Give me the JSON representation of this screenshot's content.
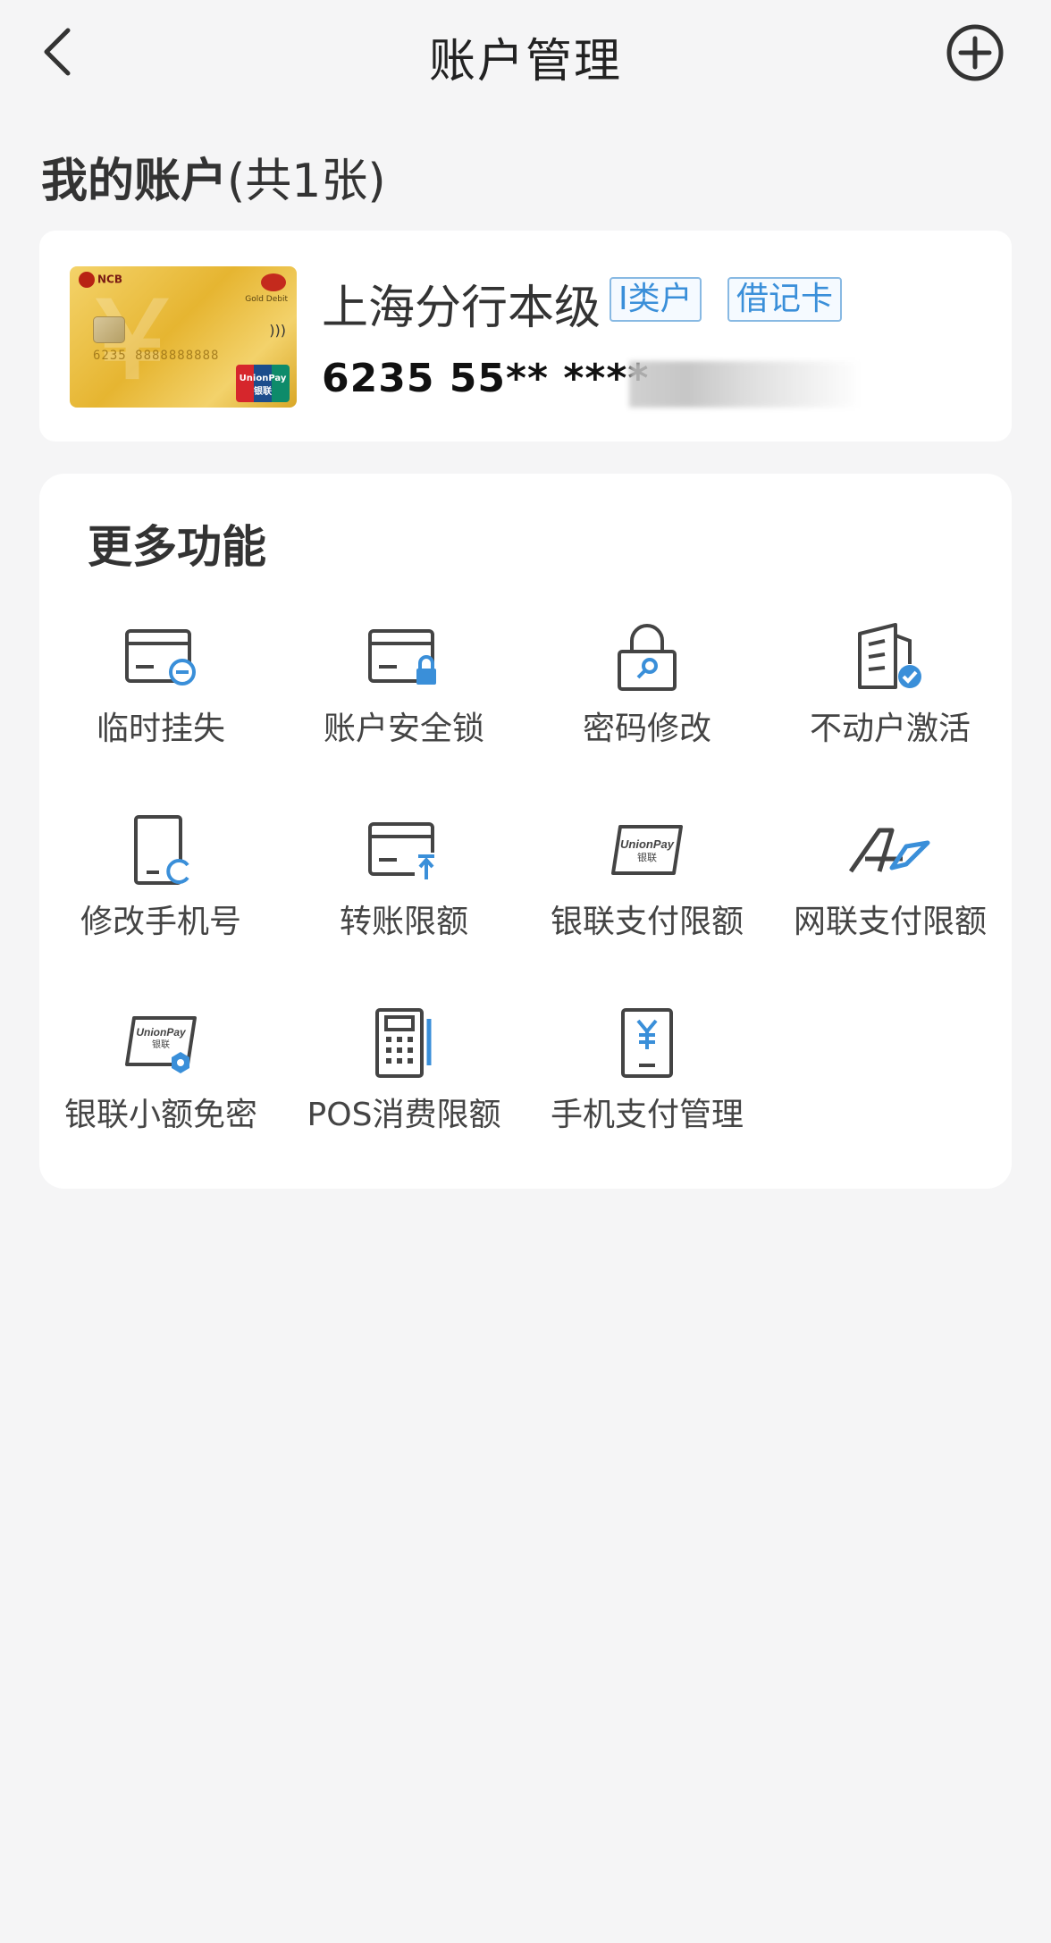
{
  "header": {
    "title": "账户管理",
    "back_icon": "chevron-left-icon",
    "add_icon": "plus-circle-icon"
  },
  "accounts": {
    "title": "我的账户",
    "count_text": "(共1张)"
  },
  "account_card": {
    "branch": "上海分行本级",
    "tag_class": "I类户",
    "tag_type": "借记卡",
    "card_number": "6235 55** ****",
    "card_brand_text": "NCB",
    "card_type_text": "Gold Debit",
    "unionpay_text": "UnionPay 银联"
  },
  "functions": {
    "title": "更多功能",
    "items": [
      {
        "label": "临时挂失",
        "icon": "card-minus-icon"
      },
      {
        "label": "账户安全锁",
        "icon": "card-lock-icon"
      },
      {
        "label": "密码修改",
        "icon": "padlock-key-icon"
      },
      {
        "label": "不动户激活",
        "icon": "building-check-icon"
      },
      {
        "label": "修改手机号",
        "icon": "phone-refresh-icon"
      },
      {
        "label": "转账限额",
        "icon": "card-upload-icon"
      },
      {
        "label": "银联支付限额",
        "icon": "unionpay-card-icon"
      },
      {
        "label": "网联支付限额",
        "icon": "netunion-logo-icon"
      },
      {
        "label": "银联小额免密",
        "icon": "unionpay-badge-icon"
      },
      {
        "label": "POS消费限额",
        "icon": "pos-terminal-icon"
      },
      {
        "label": "手机支付管理",
        "icon": "phone-yuan-icon"
      }
    ]
  },
  "colors": {
    "accent": "#3a8fd9",
    "icon_dark": "#444444",
    "background": "#f5f5f6",
    "card_gold": "#e6b531"
  }
}
